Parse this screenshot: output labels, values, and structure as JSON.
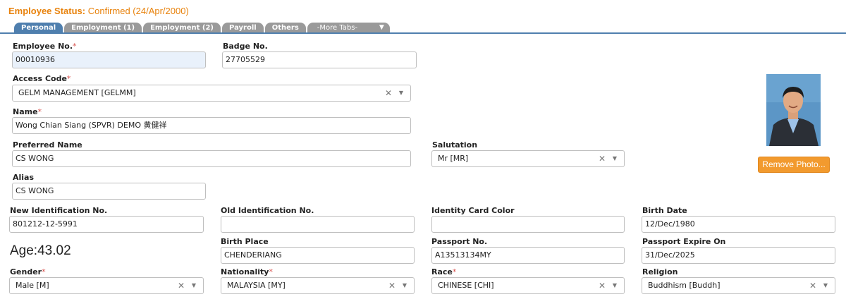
{
  "status": {
    "label": "Employee Status:",
    "value": "Confirmed (24/Apr/2000)"
  },
  "tabs": [
    {
      "label": "Personal",
      "active": true
    },
    {
      "label": "Employment (1)"
    },
    {
      "label": "Employment (2)"
    },
    {
      "label": "Payroll"
    },
    {
      "label": "Others"
    },
    {
      "label": "-More Tabs-"
    }
  ],
  "fields": {
    "employee_no": {
      "label": "Employee No.",
      "value": "00010936"
    },
    "badge_no": {
      "label": "Badge No.",
      "value": "27705529"
    },
    "access_code": {
      "label": "Access Code",
      "value": "GELM MANAGEMENT [GELMM]"
    },
    "name": {
      "label": "Name",
      "value": "Wong Chian Siang (SPVR) DEMO 黄健祥"
    },
    "preferred_name": {
      "label": "Preferred Name",
      "value": "CS WONG"
    },
    "salutation": {
      "label": "Salutation",
      "value": "Mr [MR]"
    },
    "alias": {
      "label": "Alias",
      "value": "CS WONG"
    },
    "new_ic": {
      "label": "New Identification No.",
      "value": "801212-12-5991"
    },
    "old_ic": {
      "label": "Old Identification No.",
      "value": ""
    },
    "ic_color": {
      "label": "Identity Card Color",
      "value": ""
    },
    "birth_date": {
      "label": "Birth Date",
      "value": "12/Dec/1980"
    },
    "birth_place": {
      "label": "Birth Place",
      "value": "CHENDERIANG"
    },
    "passport_no": {
      "label": "Passport No.",
      "value": "A13513134MY"
    },
    "passport_expire": {
      "label": "Passport Expire On",
      "value": "31/Dec/2025"
    },
    "gender": {
      "label": "Gender",
      "value": "Male [M]"
    },
    "nationality": {
      "label": "Nationality",
      "value": "MALAYSIA [MY]"
    },
    "race": {
      "label": "Race",
      "value": "CHINESE [CHI]"
    },
    "religion": {
      "label": "Religion",
      "value": "Buddhism [Buddh]"
    }
  },
  "age": "Age:43.02",
  "photo": {
    "remove_label": "Remove Photo..."
  },
  "icons": {
    "clear": "clear-icon",
    "caret": "caret-down-icon",
    "chevron": "chevron-down-icon"
  },
  "colors": {
    "accent": "#e8820c",
    "tab_active": "#4f7fae",
    "tab_inactive": "#9a9a9a",
    "button": "#f29a2e"
  }
}
